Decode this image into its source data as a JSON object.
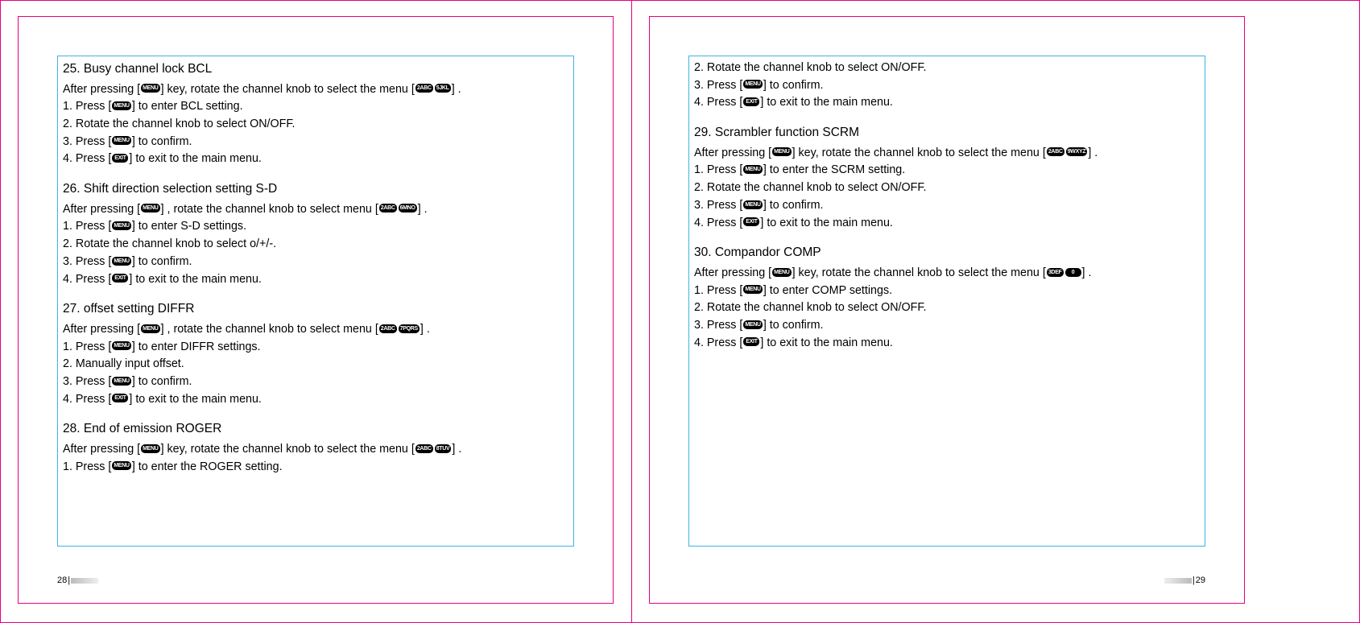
{
  "keys": {
    "menu": "MENU",
    "exit": "EXIT",
    "d2": "2ABC",
    "d3": "3DEF",
    "d5": "5JKL",
    "d6": "6MNO",
    "d7": "7PQRS",
    "d8": "8TUV",
    "d9": "9WXYZ",
    "d0": "0"
  },
  "left": {
    "s25": {
      "title": "25. Busy channel lock BCL",
      "intro_a": "After pressing [",
      "intro_b": "] key, rotate the channel knob to select the menu [",
      "intro_c": "] .",
      "l1a": "1. Press [",
      "l1b": "] to enter BCL setting.",
      "l2": "2. Rotate the channel knob to select ON/OFF.",
      "l3a": "3. Press [",
      "l3b": "] to confirm.",
      "l4a": "4. Press [",
      "l4b": "] to exit to the main menu."
    },
    "s26": {
      "title": "26. Shift direction selection setting S-D",
      "intro_a": "After pressing [",
      "intro_b": "] , rotate the channel knob to select menu [",
      "intro_c": "] .",
      "l1a": "1. Press [",
      "l1b": "] to enter S-D settings.",
      "l2": "2. Rotate the channel knob to select o/+/-.",
      "l3a": "3. Press [",
      "l3b": "] to confirm.",
      "l4a": "4. Press [",
      "l4b": "] to exit to the main menu."
    },
    "s27": {
      "title": "27. offset setting DIFFR",
      "intro_a": "After pressing [",
      "intro_b": "] , rotate the channel knob to select menu [",
      "intro_c": "] .",
      "l1a": "1. Press [",
      "l1b": "] to enter DIFFR settings.",
      "l2": "2. Manually input offset.",
      "l3a": "3. Press [",
      "l3b": "] to confirm.",
      "l4a": "4. Press [",
      "l4b": "] to exit to the main menu."
    },
    "s28": {
      "title": "28. End of emission ROGER",
      "intro_a": "After pressing [",
      "intro_b": "] key, rotate the channel knob to select the menu [",
      "intro_c": "] .",
      "l1a": "1. Press [",
      "l1b": "] to enter the ROGER setting."
    },
    "pageNum": "28"
  },
  "right": {
    "cont": {
      "l2": "2. Rotate the channel knob to select ON/OFF.",
      "l3a": "3. Press [",
      "l3b": "] to confirm.",
      "l4a": "4. Press [",
      "l4b": "] to exit to the main menu."
    },
    "s29": {
      "title": "29. Scrambler function SCRM",
      "intro_a": "After pressing [",
      "intro_b": "] key, rotate the channel knob to select the menu [",
      "intro_c": "] .",
      "l1a": "1. Press [",
      "l1b": "] to enter the SCRM setting.",
      "l2": "2. Rotate the channel knob to select ON/OFF.",
      "l3a": "3. Press [",
      "l3b": "]  to confirm.",
      "l4a": "4. Press [",
      "l4b": "]  to exit to the main menu."
    },
    "s30": {
      "title": "30. Compandor COMP",
      "intro_a": "After pressing [",
      "intro_b": "] key, rotate the channel knob to select the menu [",
      "intro_c": "] .",
      "l1a": "1. Press [",
      "l1b": "] to enter COMP settings.",
      "l2": "2. Rotate the channel knob to select ON/OFF.",
      "l3a": "3. Press [",
      "l3b": "] to confirm.",
      "l4a": "4. Press [",
      "l4b": "] to exit to the main menu."
    },
    "pageNum": "29"
  }
}
